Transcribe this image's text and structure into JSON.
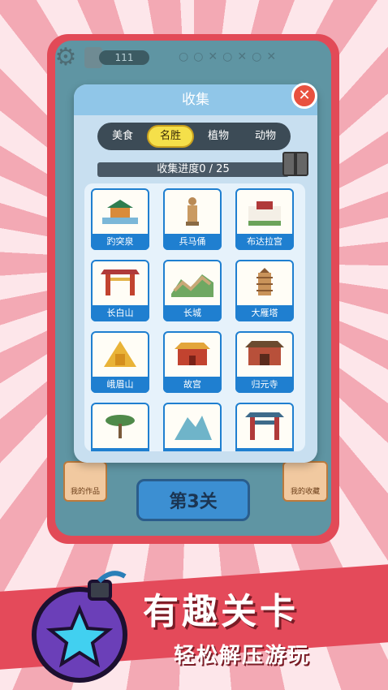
{
  "hud": {
    "coins": "111"
  },
  "background": {
    "level_button": "第3关",
    "my_works": "我的作品",
    "my_collection": "我的收藏"
  },
  "modal": {
    "title": "收集",
    "close_symbol": "✕",
    "tabs": [
      {
        "label": "美食",
        "active": false
      },
      {
        "label": "名胜",
        "active": true
      },
      {
        "label": "植物",
        "active": false
      },
      {
        "label": "动物",
        "active": false
      }
    ],
    "progress_text": "收集进度0 / 25",
    "cards": [
      {
        "label": "趵突泉"
      },
      {
        "label": "兵马俑"
      },
      {
        "label": "布达拉宫"
      },
      {
        "label": "长白山"
      },
      {
        "label": "长城"
      },
      {
        "label": "大雁塔"
      },
      {
        "label": "峨眉山"
      },
      {
        "label": "故宫"
      },
      {
        "label": "归元寺"
      },
      {
        "label": ""
      },
      {
        "label": ""
      },
      {
        "label": ""
      }
    ]
  },
  "banner": {
    "title": "有趣关卡",
    "subtitle": "轻松解压游玩"
  },
  "colors": {
    "accent_red": "#e24a57",
    "tab_active": "#f5e04a",
    "card_blue": "#1f7fd0"
  }
}
